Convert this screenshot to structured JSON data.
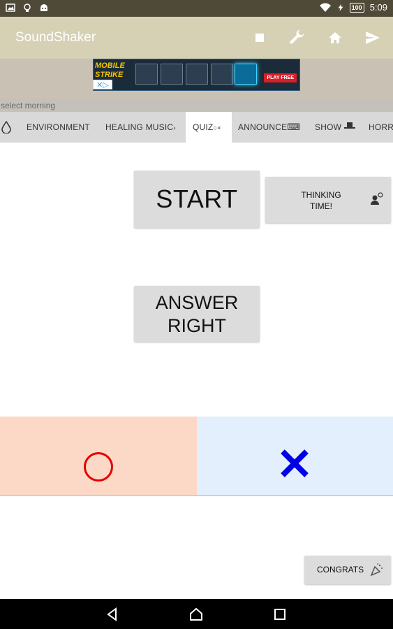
{
  "status_bar": {
    "time": "5:09",
    "battery": "100",
    "icons": [
      "gallery-icon",
      "bulb-icon",
      "android-icon",
      "wifi-icon",
      "bolt-icon",
      "battery-icon"
    ]
  },
  "app_bar": {
    "title": "SoundShaker",
    "actions": [
      "stop-icon",
      "wrench-icon",
      "home-icon",
      "send-icon"
    ]
  },
  "ad": {
    "logo_line1": "MOBILE",
    "logo_line2": "STRIKE",
    "cta": "PLAY FREE",
    "choices": "✕▷"
  },
  "sub_label": "select morning",
  "tabs": [
    {
      "label": "",
      "icon": "drop-icon"
    },
    {
      "label": "ENVIRONMENT"
    },
    {
      "label": "HEALING MUSIC",
      "icon": "music-icon"
    },
    {
      "label": "QUIZ",
      "icon": "quiz-icon",
      "active": true
    },
    {
      "label": "ANNOUNCE",
      "icon": "keyboard-icon"
    },
    {
      "label": "SHOW",
      "icon": "hat-icon"
    },
    {
      "label": "HORR"
    }
  ],
  "buttons": {
    "start": "START",
    "thinking_time": "THINKING TIME!",
    "answer_line1": "ANSWER",
    "answer_line2": "RIGHT",
    "congrats": "CONGRATS"
  },
  "colors": {
    "status_bar": "#4f4a37",
    "app_bar": "#d6d1b4",
    "correct_panel": "#fbd9c6",
    "wrong_panel": "#e3effc",
    "correct_mark": "#e60000",
    "wrong_mark": "#0000e6"
  }
}
